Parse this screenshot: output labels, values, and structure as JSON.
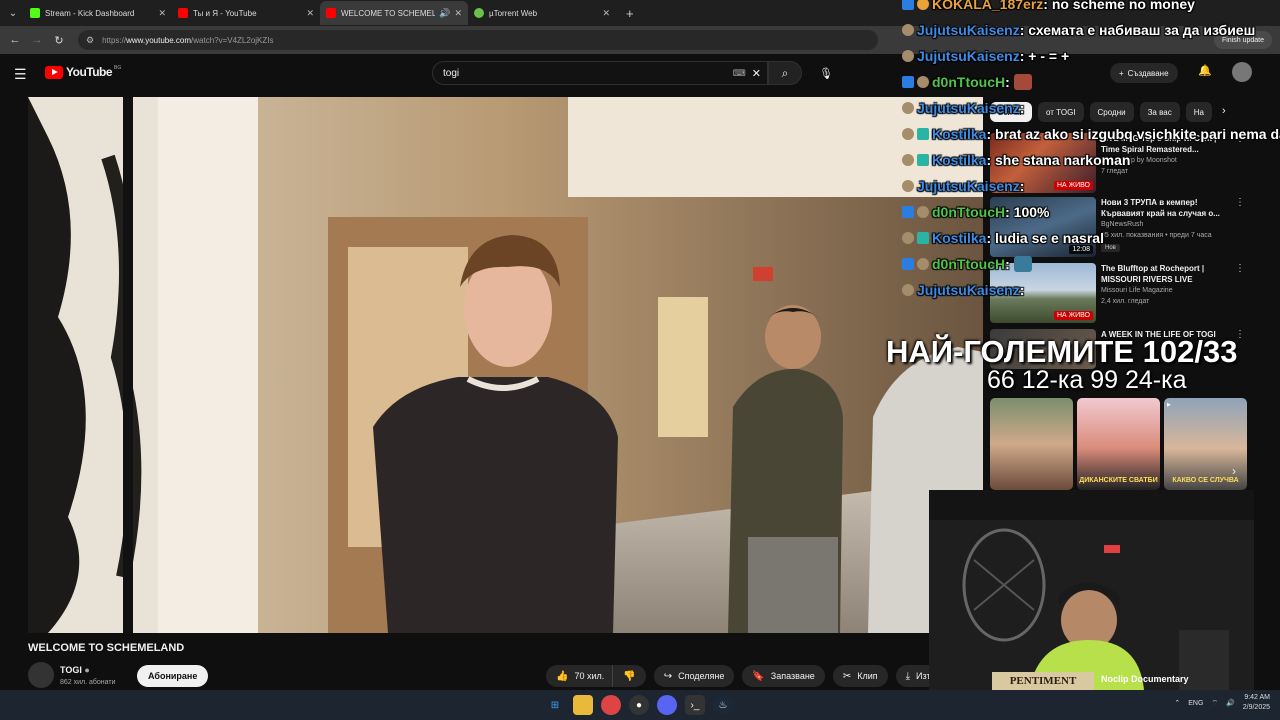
{
  "browser": {
    "tabs": [
      {
        "label": "Stream - Kick Dashboard",
        "color": "#53fc18",
        "active": false
      },
      {
        "label": "Ты и Я - YouTube",
        "color": "#ff0000",
        "active": false
      },
      {
        "label": "WELCOME TO SCHEMELAND",
        "color": "#ff0000",
        "active": true
      },
      {
        "label": "µTorrent Web",
        "color": "#6cc04a",
        "active": false
      }
    ],
    "url_protocol": "https://",
    "url_host": "www.youtube.com",
    "url_path": "/watch?v=V4ZL2ojKZIs",
    "finish_update": "Finish update"
  },
  "youtube": {
    "logo": "YouTube",
    "region": "BG",
    "search_value": "togi",
    "create_label": "Създаване",
    "video_title": "WELCOME TO SCHEMELAND",
    "channel_name": "TOGI",
    "channel_subs": "862 хил. абонати",
    "subscribe_label": "Абониране",
    "likes": "70 хил.",
    "share_label": "Споделяне",
    "save_label": "Запазване",
    "clip_label": "Клип",
    "download_label": "Изтегляне",
    "chips": [
      "Всички",
      "от TOGI",
      "Сродни",
      "За вас",
      "На"
    ],
    "recommendations": [
      {
        "title": "LIVE MTG Top 8 Ship w/ Clint | Time Spiral Remastered...",
        "channel": "Flip & Ship by Moonshot",
        "meta": "7 гледат",
        "badge": "НА ЖИВО",
        "live": true,
        "new": ""
      },
      {
        "title": "Нови 3 ТРУПА в кемпер! Кървавият край на случая о...",
        "channel": "BgNewsRush",
        "meta": "35 хил. показвания • преди 7 часа",
        "badge": "12:08",
        "live": false,
        "new": "Нов"
      },
      {
        "title": "The Blufftop at Rocheport | MISSOURI RIVERS LIVE",
        "channel": "Missouri Life Magazine",
        "meta": "2,4 хил. гледат",
        "badge": "НА ЖИВО",
        "live": true,
        "new": ""
      },
      {
        "title": "A WEEK IN THE LIFE OF TOGI",
        "channel": "",
        "meta": "",
        "badge": "",
        "live": false,
        "new": ""
      }
    ],
    "shorts": [
      {
        "caption": ""
      },
      {
        "caption": "ДИКАНСКИТЕ СВАТБИ"
      },
      {
        "caption": "КАКВО СЕ СЛУЧВА"
      }
    ]
  },
  "chat": [
    {
      "user": "KOKALA_187erz",
      "msg": ": no scheme no money",
      "gold": true
    },
    {
      "user": "JujutsuKaisenz",
      "msg": ": схемата е набиваш за да избиеш",
      "gold": false
    },
    {
      "user": "JujutsuKaisenz",
      "msg": ": + - = +",
      "gold": false
    },
    {
      "user": "d0nTtoucH",
      "msg": ":",
      "gold": false,
      "emote": true
    },
    {
      "user": "JujutsuKaisenz",
      "msg": ":",
      "gold": false
    },
    {
      "user": "Kostilka",
      "msg": ": brat az ako si izgubq vsichkite pari nema da",
      "gold": false
    },
    {
      "user": "Kostilka",
      "msg": ": she stana narkoman",
      "gold": false
    },
    {
      "user": "JujutsuKaisenz",
      "msg": ":",
      "gold": false
    },
    {
      "user": "d0nTtoucH",
      "msg": ": 100%",
      "gold": false
    },
    {
      "user": "Kostilka",
      "msg": ": ludia se e nasral",
      "gold": false
    },
    {
      "user": "d0nTtoucH",
      "msg": ":",
      "gold": false,
      "emote": true
    },
    {
      "user": "JujutsuKaisenz",
      "msg": ":",
      "gold": false
    }
  ],
  "overlay": {
    "headline": "НАЙ-ГОЛЕМИТЕ 102/33",
    "subline": "66 12-ка 99 24-ка"
  },
  "webcam": {
    "game_logo": "PENTIMENT",
    "game_name": "Noclip Documentary"
  },
  "taskbar": {
    "lang": "ENG",
    "time": "9:42 AM",
    "date": "2/9/2025"
  }
}
